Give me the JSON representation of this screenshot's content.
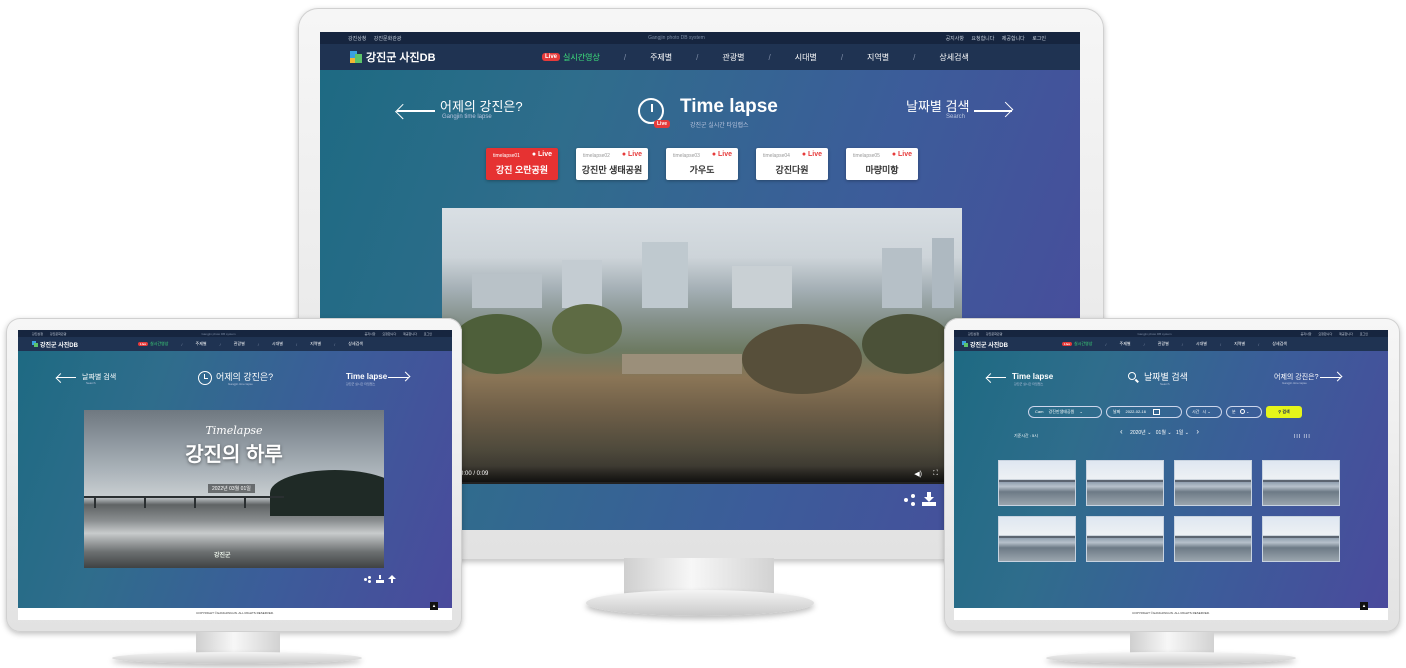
{
  "site": {
    "util_left": [
      "강진상청",
      "강진문화관광"
    ],
    "util_center": "Gangjin photo DB system",
    "util_right": [
      "공지사항",
      "요청합니다",
      "제공합니다",
      "로그인"
    ],
    "logo": "강진군 사진DB",
    "nav": [
      "실시간영상",
      "주제별",
      "관광별",
      "시대별",
      "지역별",
      "상세검색"
    ],
    "live_badge": "Live",
    "copyright": "COPYRIGHT ©GANGJINGUN. ALL RIGHTS RESERVED."
  },
  "main_monitor": {
    "prev_title": "어제의 강진은?",
    "prev_sub": "Gangjin time lapse",
    "title": "Time lapse",
    "title_sub": "강진군 실시간 타임랩스",
    "next_title": "날짜별 검색",
    "next_sub": "Search",
    "live_label": "Live",
    "tabs": [
      {
        "cam": "timelapse01",
        "name": "강진 오란공원",
        "live": "● Live"
      },
      {
        "cam": "timelapse02",
        "name": "강진만 생태공원",
        "live": "● Live"
      },
      {
        "cam": "timelapse03",
        "name": "가우도",
        "live": "● Live"
      },
      {
        "cam": "timelapse04",
        "name": "강진다원",
        "live": "● Live"
      },
      {
        "cam": "timelapse05",
        "name": "마량미항",
        "live": "● Live"
      }
    ],
    "video_time": "0:00 / 0:09"
  },
  "left_monitor": {
    "prev_title": "날짜별 검색",
    "prev_sub": "Search",
    "title": "어제의 강진은?",
    "title_sub": "Gangjin time lapse",
    "next_title": "Time lapse",
    "next_sub": "강진군 실시간 타임랩스",
    "video_script": "Timelapse",
    "video_title": "강진의 하루",
    "video_date": "2022년 03월 01일",
    "video_logo": "강진군"
  },
  "right_monitor": {
    "prev_title": "Time lapse",
    "prev_sub": "강진군 실시간 타임랩스",
    "title": "날짜별 검색",
    "title_sub": "Search",
    "next_title": "어제의 강진은?",
    "next_sub": "Gangjin time lapse",
    "cam_label": "Cam",
    "cam_value": "강진만생태공원",
    "date_label": "날짜",
    "date_value": "2022-02-16",
    "time_label": "시간",
    "time_value": "시",
    "minute_label": "분",
    "search_button": "검색",
    "period_year": "2020년",
    "period_month": "01월",
    "period_day": "1일",
    "time_filter": "기준시간 : 5시",
    "thumbnail_count": 8
  },
  "colors": {
    "active_nav": "#3ee27c",
    "live_red": "#e63a3a",
    "search_yellow": "#e6f51a"
  }
}
